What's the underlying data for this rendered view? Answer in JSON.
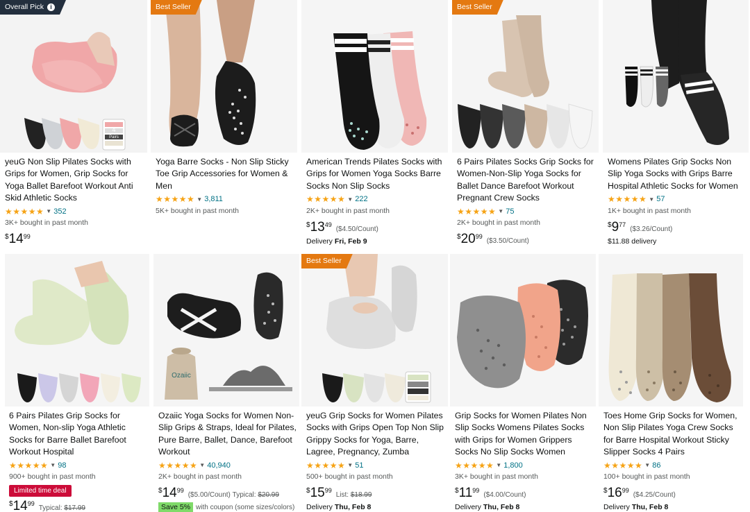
{
  "products": [
    {
      "badge": "Overall Pick",
      "title": "yeuG Non Slip Pilates Socks with Grips for Women, Grip Socks for Yoga Ballet Barefoot Workout Anti Skid Athletic Socks",
      "stars": "★★★★★",
      "rating_count": "352",
      "bought": "3K+ bought in past month",
      "price_sym": "$",
      "price_whole": "14",
      "price_frac": "99",
      "unit_price": "",
      "delivery_label": "",
      "delivery_date": ""
    },
    {
      "badge": "Best Seller",
      "title": "Yoga Barre Socks - Non Slip Sticky Toe Grip Accessories for Women & Men",
      "stars": "★★★★★",
      "rating_count": "3,811",
      "bought": "5K+ bought in past month",
      "price_sym": "",
      "price_whole": "",
      "price_frac": "",
      "unit_price": "",
      "delivery_label": "",
      "delivery_date": ""
    },
    {
      "badge": "",
      "title": "American Trends Pilates Socks with Grips for Women Yoga Socks Barre Socks Non Slip Socks",
      "stars": "★★★★★",
      "rating_count": "222",
      "bought": "2K+ bought in past month",
      "price_sym": "$",
      "price_whole": "13",
      "price_frac": "49",
      "unit_price": "($4.50/Count)",
      "delivery_label": "Delivery",
      "delivery_date": "Fri, Feb 9"
    },
    {
      "badge": "Best Seller",
      "title": "6 Pairs Pilates Socks Grip Socks for Women-Non-Slip Yoga Socks for Ballet Dance Barefoot Workout Pregnant Crew Socks",
      "stars": "★★★★★",
      "rating_count": "75",
      "bought": "2K+ bought in past month",
      "price_sym": "$",
      "price_whole": "20",
      "price_frac": "99",
      "unit_price": "($3.50/Count)",
      "delivery_label": "",
      "delivery_date": ""
    },
    {
      "badge": "",
      "title": "Womens Pilates Grip Socks Non Slip Yoga Socks with Grips Barre Hospital Athletic Socks for Women",
      "stars": "★★★★★",
      "rating_count": "57",
      "bought": "1K+ bought in past month",
      "price_sym": "$",
      "price_whole": "9",
      "price_frac": "77",
      "unit_price": "($3.26/Count)",
      "delivery_label": "$11.88 delivery",
      "delivery_date": ""
    },
    {
      "badge": "",
      "title": "6 Pairs Pilates Grip Socks for Women, Non-slip Yoga Athletic Socks for Barre Ballet Barefoot Workout Hospital",
      "stars": "★★★★★",
      "rating_count": "98",
      "bought": "900+ bought in past month",
      "deal": "Limited time deal",
      "price_sym": "$",
      "price_whole": "14",
      "price_frac": "99",
      "typical_label": "Typical:",
      "typical_price": "$17.99"
    },
    {
      "badge": "",
      "title": "Ozaiic Yoga Socks for Women Non-Slip Grips & Straps, Ideal for Pilates, Pure Barre, Ballet, Dance, Barefoot Workout",
      "stars": "★★★★★",
      "rating_count": "40,940",
      "bought": "2K+ bought in past month",
      "price_sym": "$",
      "price_whole": "14",
      "price_frac": "99",
      "unit_price": "($5.00/Count)",
      "typical_label": "Typical:",
      "typical_price": "$20.99",
      "save_tag": "Save 5%",
      "save_text": "with coupon (some sizes/colors)"
    },
    {
      "badge": "Best Seller",
      "title": "yeuG Grip Socks for Women Pilates Socks with Grips Open Top Non Slip Grippy Socks for Yoga, Barre, Lagree, Pregnancy, Zumba",
      "stars": "★★★★★",
      "rating_count": "51",
      "bought": "500+ bought in past month",
      "price_sym": "$",
      "price_whole": "15",
      "price_frac": "99",
      "list_label": "List:",
      "list_price": "$18.99",
      "delivery_label": "Delivery",
      "delivery_date": "Thu, Feb 8"
    },
    {
      "badge": "",
      "title": "Grip Socks for Women Pilates Non Slip Socks Womens Pilates Socks with Grips for Women Grippers Socks No Slip Socks Women",
      "stars": "★★★★★",
      "rating_count": "1,800",
      "bought": "3K+ bought in past month",
      "price_sym": "$",
      "price_whole": "11",
      "price_frac": "99",
      "unit_price": "($4.00/Count)",
      "delivery_label": "Delivery",
      "delivery_date": "Thu, Feb 8"
    },
    {
      "badge": "",
      "title": "Toes Home Grip Socks for Women, Non Slip Pilates Yoga Crew Socks for Barre Hospital Workout Sticky Slipper Socks 4 Pairs",
      "stars": "★★★★★",
      "rating_count": "86",
      "bought": "100+ bought in past month",
      "price_sym": "$",
      "price_whole": "16",
      "price_frac": "99",
      "unit_price": "($4.25/Count)",
      "delivery_label": "Delivery",
      "delivery_date": "Thu, Feb 8"
    }
  ],
  "image_text": {
    "brand_ozaiic": "Ozaiic",
    "pack_4": "4",
    "pairs": "Pairs"
  },
  "colors": {
    "star": "#f6a315",
    "link": "#007185",
    "badge_pick": "#232f3e",
    "badge_seller": "#e47911",
    "deal": "#cc0c39",
    "save": "#7fda69"
  }
}
